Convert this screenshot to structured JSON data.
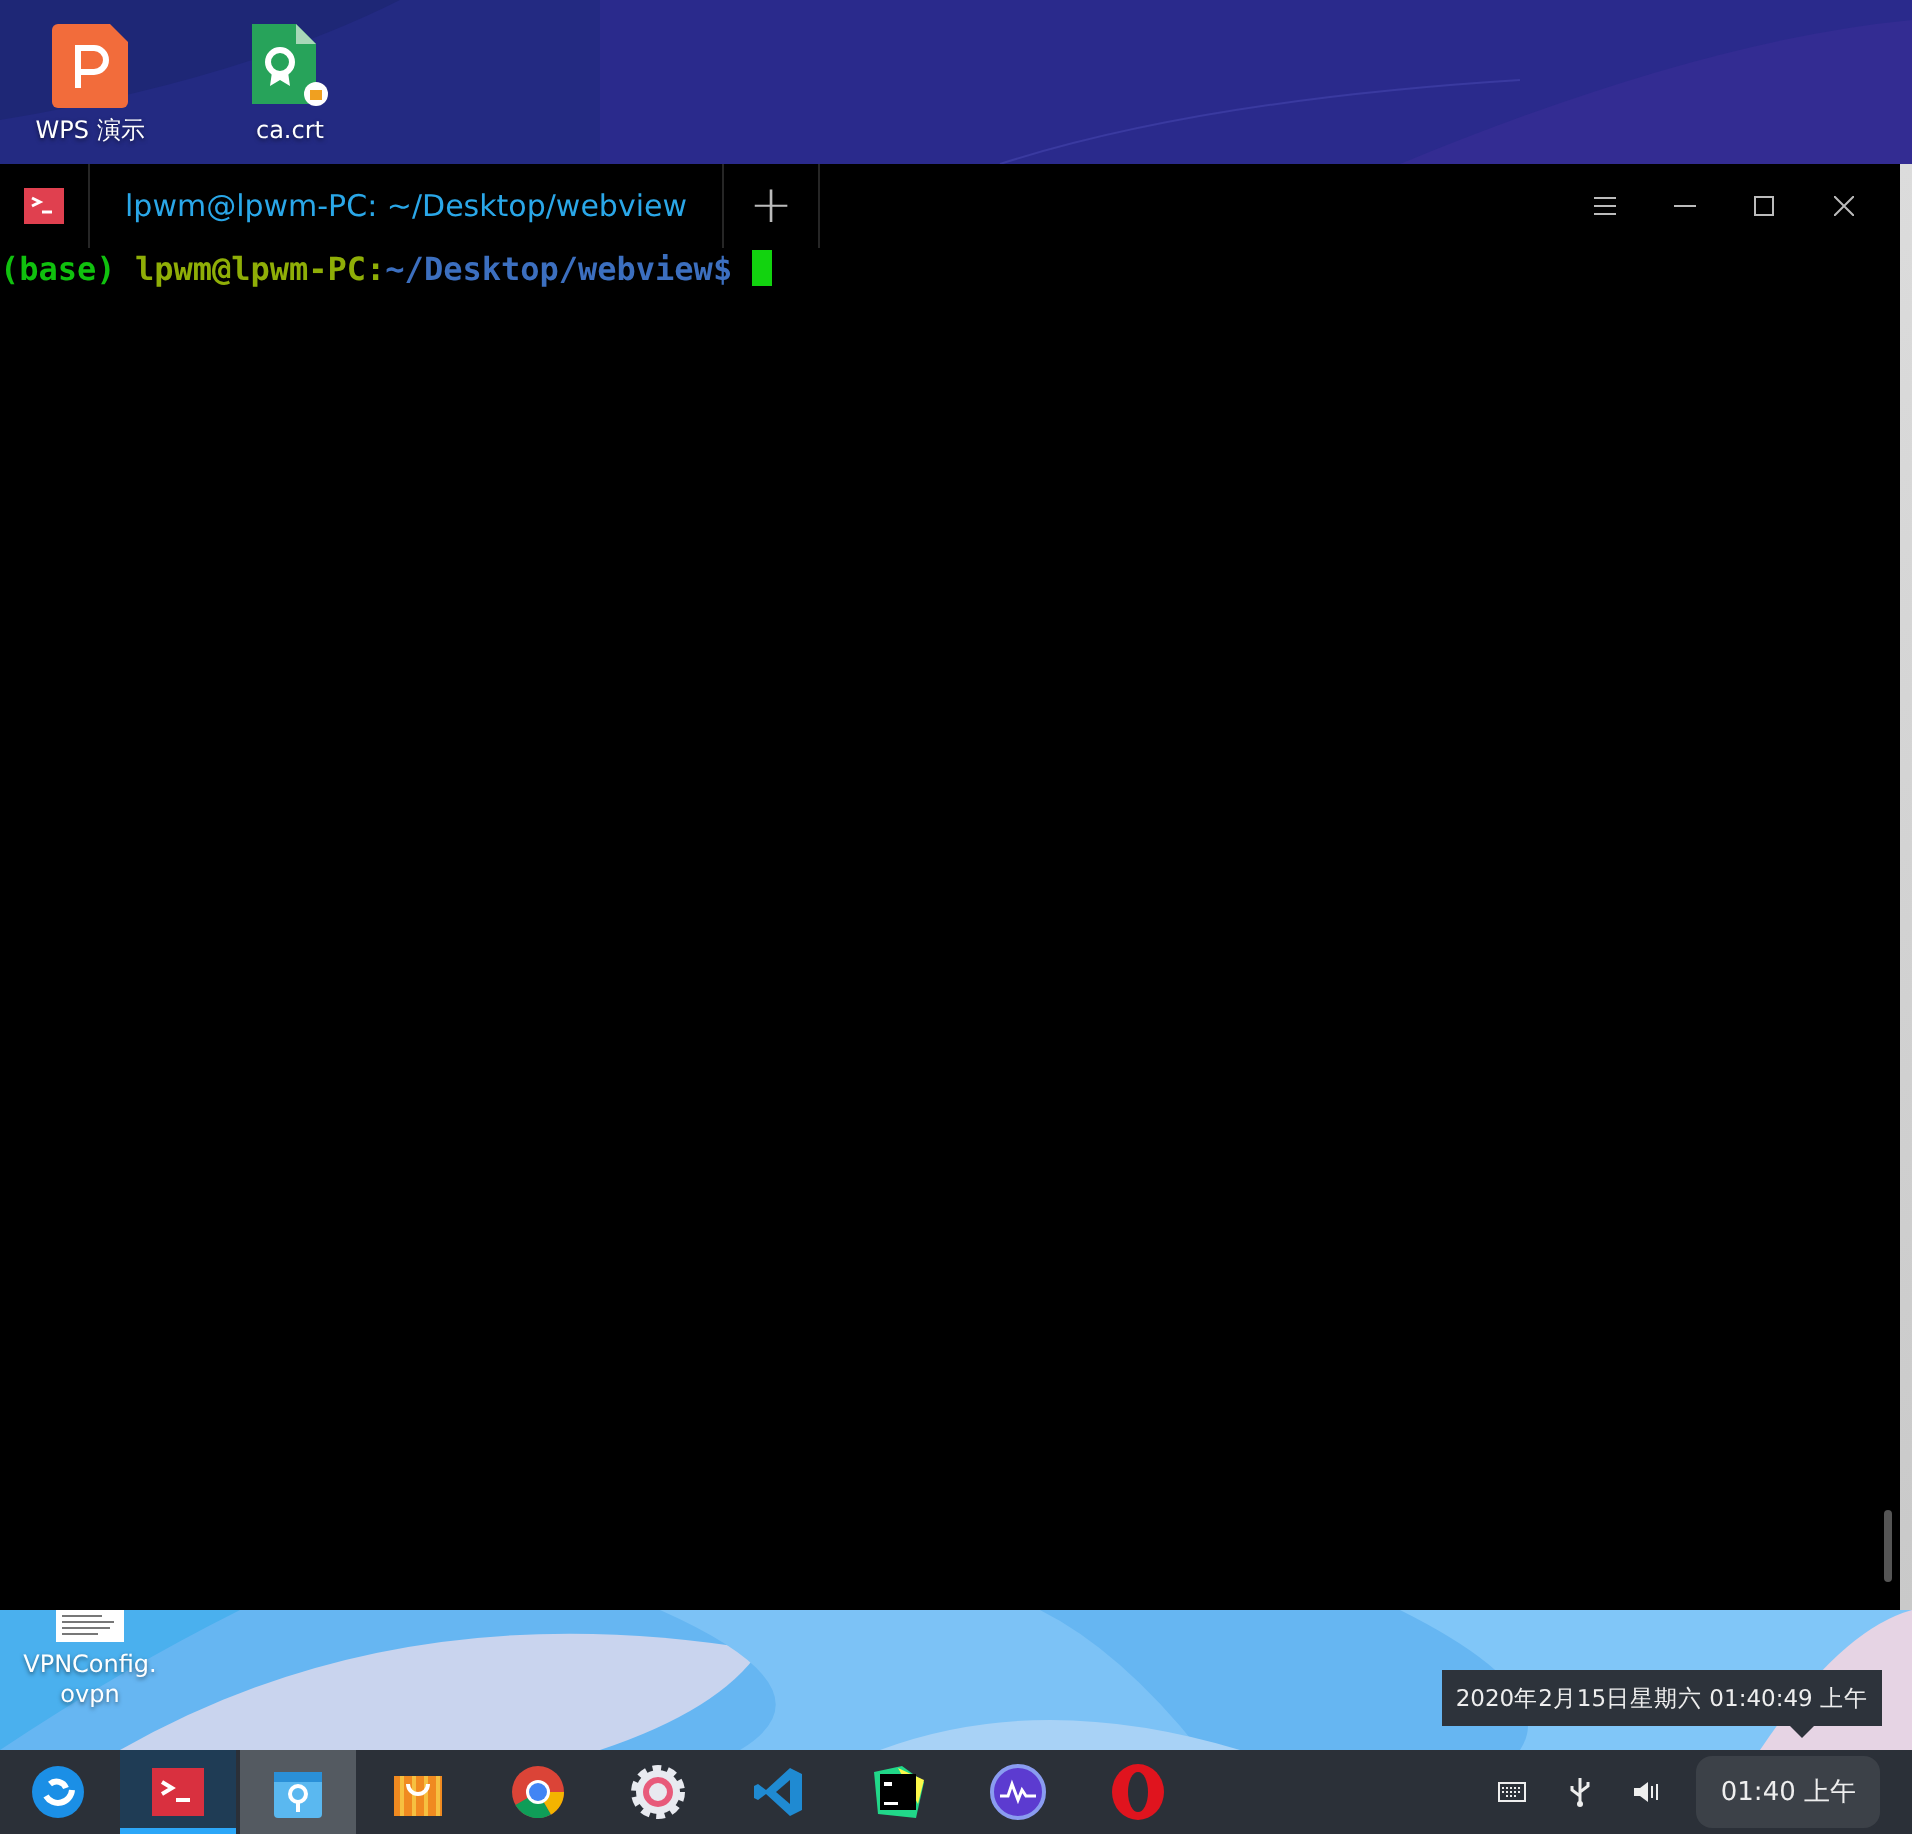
{
  "desktop_top": {
    "icons": [
      {
        "kind": "presentation",
        "label": "WPS 演示"
      },
      {
        "kind": "certificate",
        "label": "ca.crt"
      }
    ]
  },
  "terminal": {
    "tab": {
      "title": "lpwm@lpwm-PC: ~/Desktop/webview",
      "selected": true
    },
    "new_tab": "+",
    "prompt": [
      {
        "kind": "env",
        "text": "(base)"
      },
      {
        "kind": "user",
        "text": "lpwm@lpwm-PC"
      },
      {
        "kind": "separator",
        "text": ":"
      },
      {
        "kind": "path",
        "text": "~/Desktop/webview"
      },
      {
        "kind": "symbol",
        "text": "$"
      }
    ]
  },
  "desktop_bottom": {
    "icons": [
      {
        "kind": "document",
        "label_lines": [
          "VPNConfig.",
          "ovpn"
        ]
      }
    ]
  },
  "tooltip": "2020年2月15日星期六 01:40:49 上午",
  "taskbar": {
    "apps": [
      {
        "kind": "launcher",
        "active": false,
        "hovered": false
      },
      {
        "kind": "terminal",
        "active": true,
        "hovered": false
      },
      {
        "kind": "store",
        "active": false,
        "hovered": true
      },
      {
        "kind": "bag",
        "active": false,
        "hovered": false
      },
      {
        "kind": "browser",
        "active": false,
        "hovered": false
      },
      {
        "kind": "settings",
        "active": false,
        "hovered": false
      },
      {
        "kind": "editor",
        "active": false,
        "hovered": false
      },
      {
        "kind": "ide",
        "active": false,
        "hovered": false
      },
      {
        "kind": "monitor",
        "active": false,
        "hovered": false
      },
      {
        "kind": "opera",
        "active": false,
        "hovered": false
      }
    ],
    "tray": [
      {
        "kind": "keyboard"
      },
      {
        "kind": "usb"
      },
      {
        "kind": "volume"
      }
    ],
    "clock": "01:40 上午"
  }
}
